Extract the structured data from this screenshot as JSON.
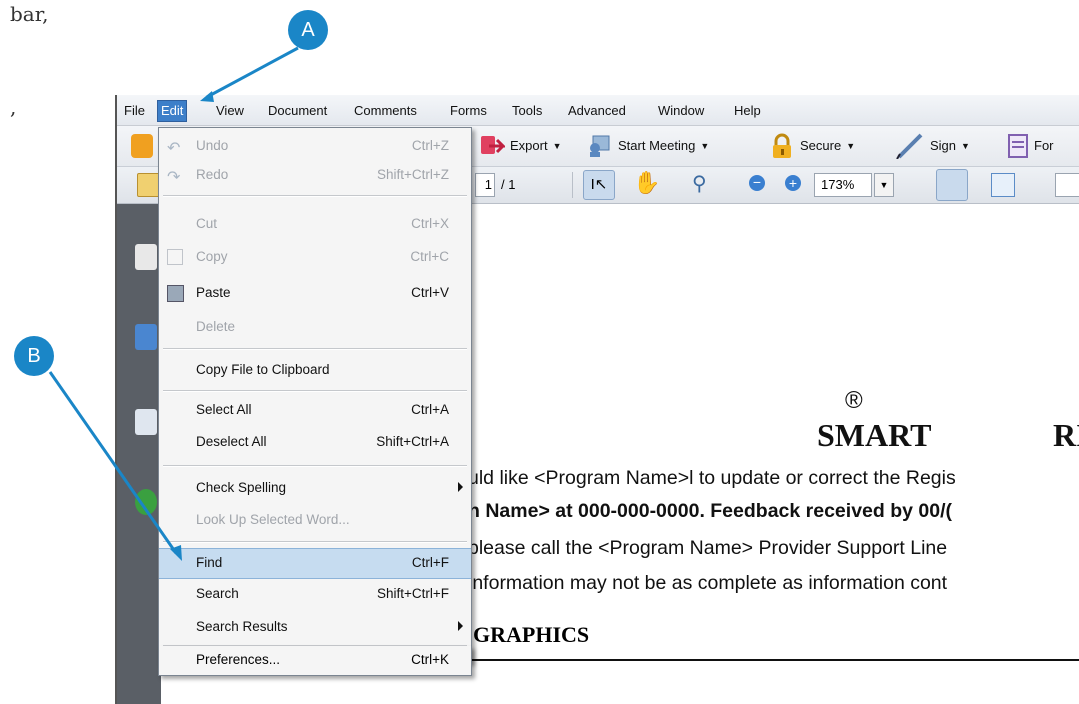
{
  "prose": {
    "top_fragment": "bar,",
    "mid_fragment": ","
  },
  "callouts": {
    "a": "A",
    "b": "B"
  },
  "menubar": {
    "items": [
      "File",
      "Edit",
      "View",
      "Document",
      "Comments",
      "Forms",
      "Tools",
      "Advanced",
      "Window",
      "Help"
    ]
  },
  "toolbar": {
    "export": "Export",
    "start_meeting": "Start Meeting",
    "secure": "Secure",
    "sign": "Sign",
    "forms_partial": "For"
  },
  "nav_toolbar": {
    "page_current": "1",
    "page_total": "/ 1",
    "zoom": "173%"
  },
  "edit_menu": {
    "items": [
      {
        "label": "Undo",
        "shortcut": "Ctrl+Z"
      },
      {
        "label": "Redo",
        "shortcut": "Shift+Ctrl+Z"
      },
      {
        "label": "Cut",
        "shortcut": "Ctrl+X"
      },
      {
        "label": "Copy",
        "shortcut": "Ctrl+C"
      },
      {
        "label": "Paste",
        "shortcut": "Ctrl+V"
      },
      {
        "label": "Delete",
        "shortcut": ""
      },
      {
        "label": "Copy File to Clipboard",
        "shortcut": ""
      },
      {
        "label": "Select All",
        "shortcut": "Ctrl+A"
      },
      {
        "label": "Deselect All",
        "shortcut": "Shift+Ctrl+A"
      },
      {
        "label": "Check Spelling",
        "shortcut": ""
      },
      {
        "label": "Look Up Selected Word...",
        "shortcut": ""
      },
      {
        "label": "Find",
        "shortcut": "Ctrl+F"
      },
      {
        "label": "Search",
        "shortcut": "Shift+Ctrl+F"
      },
      {
        "label": "Search Results",
        "shortcut": ""
      },
      {
        "label": "Preferences...",
        "shortcut": "Ctrl+K"
      }
    ]
  },
  "document": {
    "registered_mark": "®",
    "title_visible": "SMART",
    "title_cut": "RI",
    "line1": "uld like <Program Name>l to update or correct the Regis",
    "line2_bold": "n Name> at 000-000-0000.  Feedback received by 00/(",
    "line3": " please call the <Program Name> Provider Support Line",
    "line4": " information may not be as complete as information cont",
    "section_heading": "GRAPHICS"
  }
}
